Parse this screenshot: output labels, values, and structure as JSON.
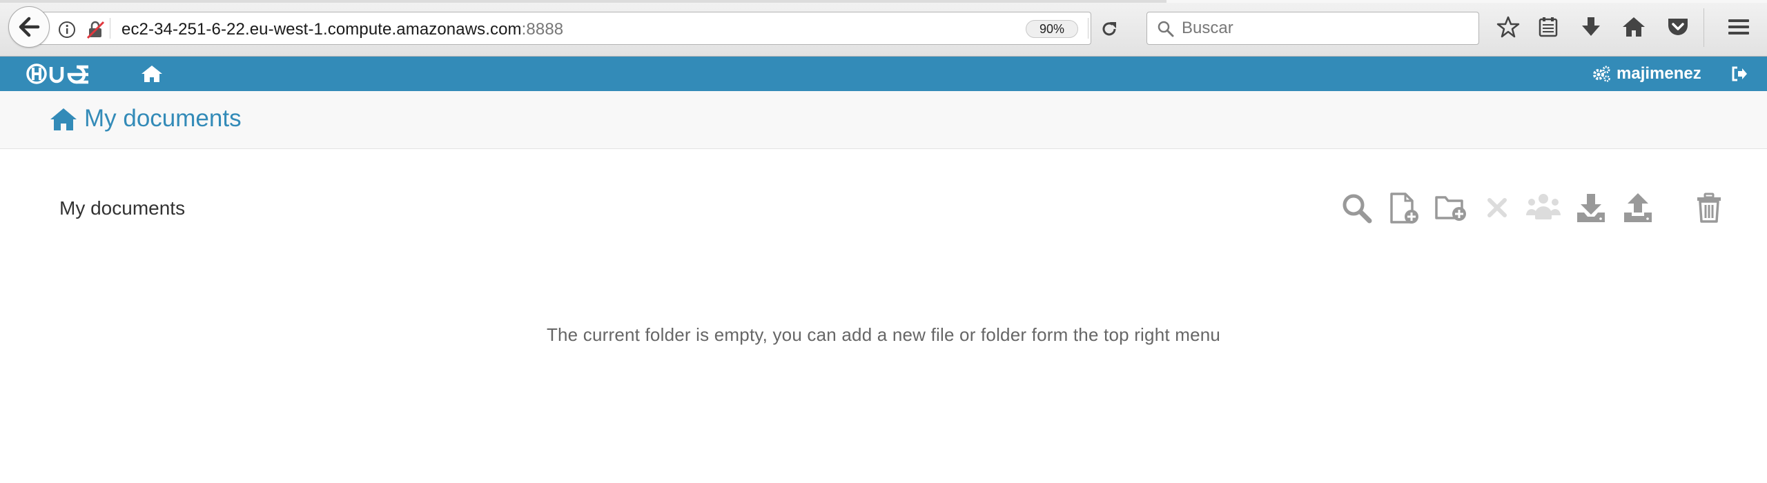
{
  "browser": {
    "url_host": "ec2-34-251-6-22.eu-west-1.compute.amazonaws.com",
    "url_port": ":8888",
    "zoom": "90%",
    "search_placeholder": "Buscar",
    "icons": [
      "back-arrow-icon",
      "info-icon",
      "mixed-content-icon",
      "reload-icon",
      "search-icon",
      "star-icon",
      "reading-list-icon",
      "download-icon",
      "home-icon",
      "pocket-icon",
      "menu-icon"
    ]
  },
  "hue_nav": {
    "logo_icon": "hue-logo-icon",
    "home_icon": "home-icon",
    "username": "majimenez",
    "user_icon": "cogs-icon",
    "logout_icon": "logout-icon"
  },
  "page": {
    "title": "My documents",
    "section_title": "My documents",
    "empty_message": "The current folder is empty, you can add a new file or folder form the top right menu"
  },
  "actions": [
    "search-icon",
    "new-document-icon",
    "new-folder-icon",
    "delete-x-icon",
    "share-users-icon",
    "download-icon",
    "upload-icon",
    "trash-icon"
  ],
  "colors": {
    "hue_blue": "#338bb8",
    "icon_gray": "#999999",
    "icon_disabled": "#dcdcdc"
  }
}
